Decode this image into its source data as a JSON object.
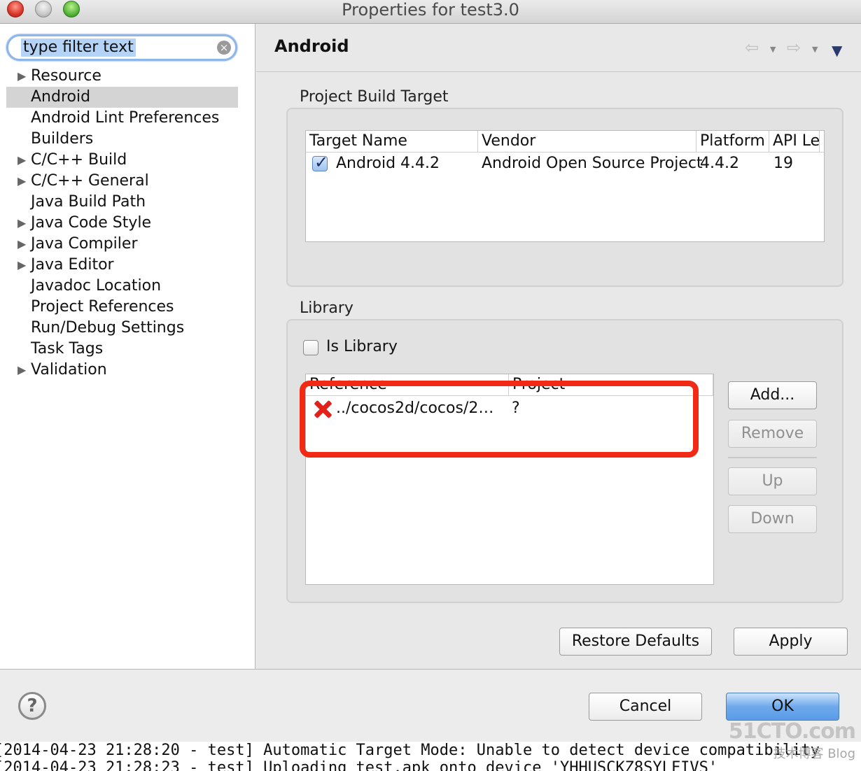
{
  "window": {
    "title": "Properties for test3.0"
  },
  "sidebar": {
    "filter_value": "type filter text",
    "items": [
      {
        "label": "Resource",
        "expandable": true,
        "selected": false
      },
      {
        "label": "Android",
        "expandable": false,
        "selected": true
      },
      {
        "label": "Android Lint Preferences",
        "expandable": false,
        "selected": false
      },
      {
        "label": "Builders",
        "expandable": false,
        "selected": false
      },
      {
        "label": "C/C++ Build",
        "expandable": true,
        "selected": false
      },
      {
        "label": "C/C++ General",
        "expandable": true,
        "selected": false
      },
      {
        "label": "Java Build Path",
        "expandable": false,
        "selected": false
      },
      {
        "label": "Java Code Style",
        "expandable": true,
        "selected": false
      },
      {
        "label": "Java Compiler",
        "expandable": true,
        "selected": false
      },
      {
        "label": "Java Editor",
        "expandable": true,
        "selected": false
      },
      {
        "label": "Javadoc Location",
        "expandable": false,
        "selected": false
      },
      {
        "label": "Project References",
        "expandable": false,
        "selected": false
      },
      {
        "label": "Run/Debug Settings",
        "expandable": false,
        "selected": false
      },
      {
        "label": "Task Tags",
        "expandable": false,
        "selected": false
      },
      {
        "label": "Validation",
        "expandable": true,
        "selected": false
      }
    ]
  },
  "page": {
    "title": "Android",
    "build_target": {
      "group_label": "Project Build Target",
      "columns": [
        "Target Name",
        "Vendor",
        "Platform",
        "API Le"
      ],
      "rows": [
        {
          "checked": true,
          "target_name": "Android 4.4.2",
          "vendor": "Android Open Source Project",
          "platform": "4.4.2",
          "api": "19"
        }
      ]
    },
    "library": {
      "group_label": "Library",
      "is_library_label": "Is Library",
      "is_library_checked": false,
      "columns": [
        "Reference",
        "Project"
      ],
      "rows": [
        {
          "reference": "../cocos2d/cocos/2…",
          "project": "?",
          "status": "error"
        }
      ],
      "buttons": {
        "add": "Add...",
        "remove": "Remove",
        "up": "Up",
        "down": "Down"
      }
    },
    "restore_defaults": "Restore Defaults",
    "apply": "Apply"
  },
  "footer": {
    "help": "?",
    "cancel": "Cancel",
    "ok": "OK"
  },
  "console": {
    "lines": [
      "[2014-04-23 21:28:20 - test] Automatic Target Mode: Unable to detect device compatibility",
      "[2014-04-23 21:28:23 - test] Uploading test.apk onto device 'YHHUSCKZ8SYLFIVS'"
    ]
  },
  "watermark": {
    "site": "51CTO.com",
    "sub": "技术博客 Blog"
  },
  "colors": {
    "highlight_box": "#f02a14",
    "error_icon": "#e2221a",
    "selection": "#b5d3f7",
    "ok_button": "#6ea9ec"
  }
}
